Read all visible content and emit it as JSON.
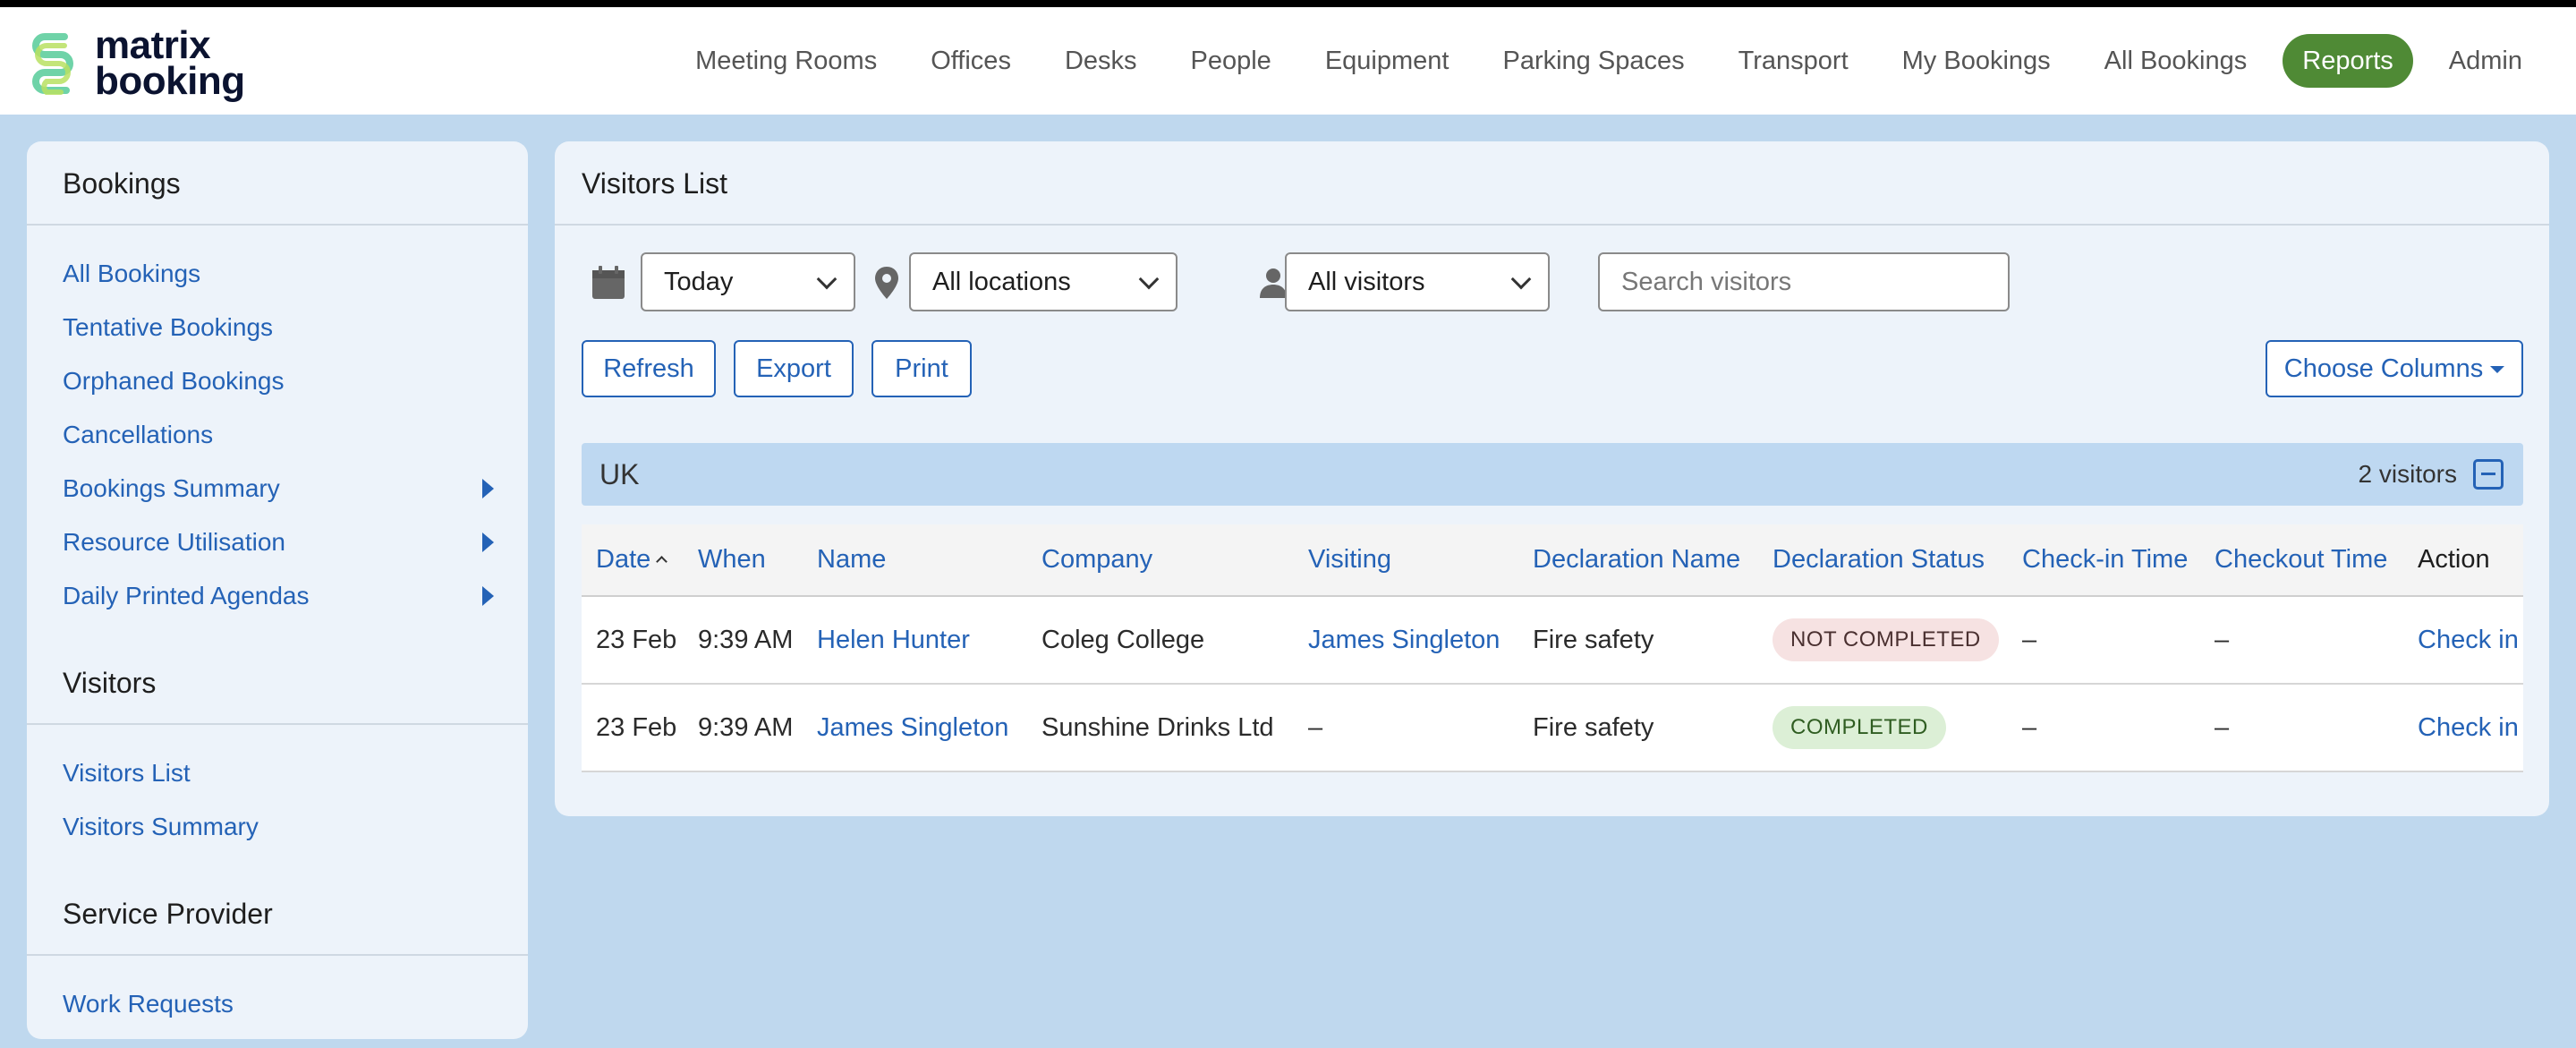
{
  "brand": {
    "line1": "matrix",
    "line2": "booking",
    "logo_icon": "matrix-booking-logo-icon"
  },
  "nav": {
    "items": [
      "Meeting Rooms",
      "Offices",
      "Desks",
      "People",
      "Equipment",
      "Parking Spaces",
      "Transport",
      "My Bookings",
      "All Bookings",
      "Reports",
      "Admin"
    ],
    "active": "Reports",
    "active_color": "#4f8a35"
  },
  "sidebar": {
    "sections": [
      {
        "title": "Bookings",
        "items": [
          {
            "label": "All Bookings",
            "submenu": false
          },
          {
            "label": "Tentative Bookings",
            "submenu": false
          },
          {
            "label": "Orphaned Bookings",
            "submenu": false
          },
          {
            "label": "Cancellations",
            "submenu": false
          },
          {
            "label": "Bookings Summary",
            "submenu": true
          },
          {
            "label": "Resource Utilisation",
            "submenu": true
          },
          {
            "label": "Daily Printed Agendas",
            "submenu": true
          }
        ]
      },
      {
        "title": "Visitors",
        "items": [
          {
            "label": "Visitors List",
            "submenu": false
          },
          {
            "label": "Visitors Summary",
            "submenu": false
          }
        ]
      },
      {
        "title": "Service Provider",
        "items": [
          {
            "label": "Work Requests",
            "submenu": false
          }
        ]
      }
    ]
  },
  "main": {
    "title": "Visitors List",
    "filters": {
      "date": "Today",
      "location": "All locations",
      "visitor": "All visitors",
      "search_placeholder": "Search visitors"
    },
    "buttons": {
      "refresh": "Refresh",
      "export": "Export",
      "print": "Print",
      "choose_columns": "Choose Columns"
    },
    "group": {
      "name": "UK",
      "count": "2 visitors"
    },
    "table": {
      "columns": [
        "Date",
        "When",
        "Name",
        "Company",
        "Visiting",
        "Declaration Name",
        "Declaration Status",
        "Check-in Time",
        "Checkout Time",
        "Action"
      ],
      "rows": [
        {
          "date": "23 Feb",
          "when": "9:39 AM",
          "name": "Helen Hunter",
          "company": "Coleg College",
          "visiting": "James Singleton",
          "declaration": "Fire safety",
          "status": "NOT COMPLETED",
          "checkin": "–",
          "checkout": "–",
          "action": "Check in"
        },
        {
          "date": "23 Feb",
          "when": "9:39 AM",
          "name": "James Singleton",
          "company": "Sunshine Drinks Ltd",
          "visiting": "–",
          "declaration": "Fire safety",
          "status": "COMPLETED",
          "checkin": "–",
          "checkout": "–",
          "action": "Check in"
        }
      ]
    }
  }
}
